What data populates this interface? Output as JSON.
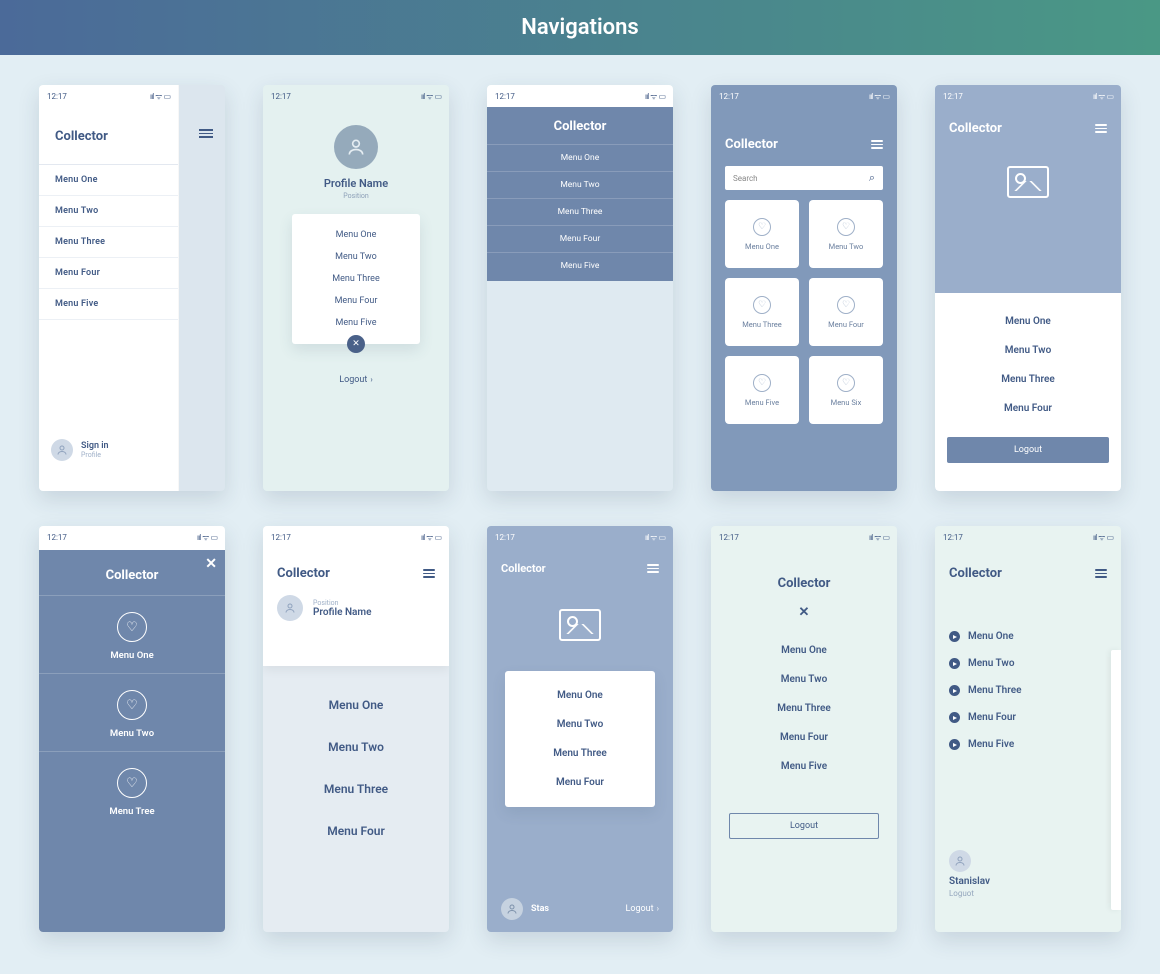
{
  "page_title": "Navigations",
  "statusbar": {
    "time": "12:17",
    "signal": "ııll",
    "wifi": "⋮⋮",
    "battery": "▮▯"
  },
  "app_name": "Collector",
  "menus5": [
    "Menu One",
    "Menu Two",
    "Menu Three",
    "Menu Four",
    "Menu Five"
  ],
  "menus4": [
    "Menu One",
    "Menu Two",
    "Menu Three",
    "Menu Four"
  ],
  "s1": {
    "signin": "Sign in",
    "profile": "Profile"
  },
  "s2": {
    "profile_name": "Profile Name",
    "position": "Position",
    "logout": "Logout"
  },
  "s4": {
    "search_placeholder": "Search",
    "cards": [
      "Menu One",
      "Menu Two",
      "Menu Three",
      "Menu Four",
      "Menu Five",
      "Menu Six"
    ]
  },
  "s5": {
    "logout": "Logout"
  },
  "s6": {
    "items": [
      "Menu One",
      "Menu Two",
      "Menu Tree"
    ]
  },
  "s7": {
    "position": "Position",
    "profile_name": "Profile Name"
  },
  "s8": {
    "user": "Stas",
    "logout": "Logout"
  },
  "s9": {
    "logout": "Logout"
  },
  "s10": {
    "user": "Stanislav",
    "logout": "Loguot"
  }
}
